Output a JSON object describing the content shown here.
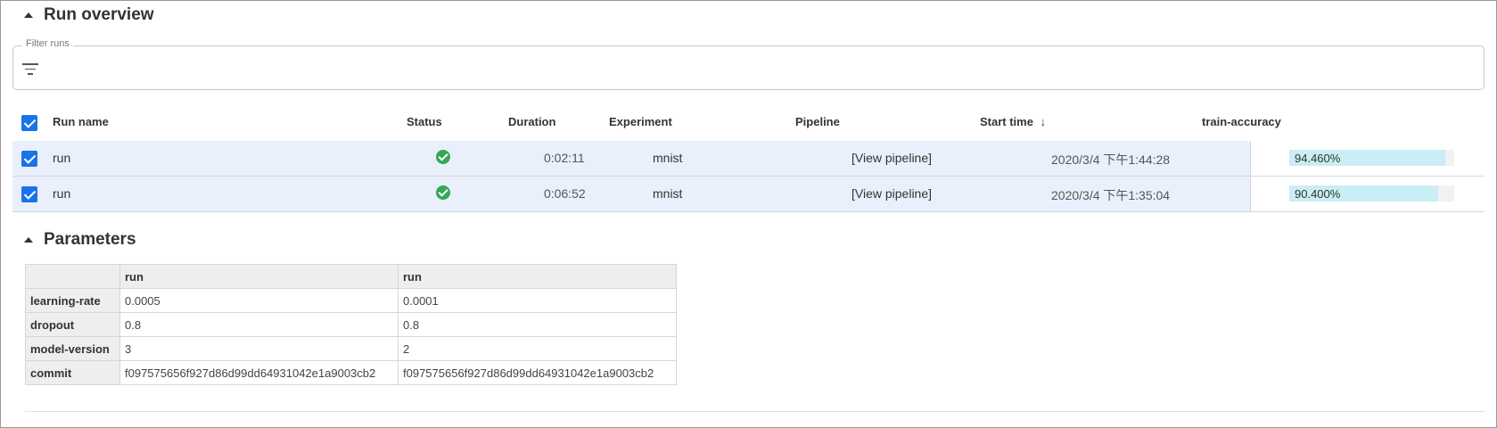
{
  "overview": {
    "title": "Run overview"
  },
  "filter": {
    "label": "Filter runs",
    "value": ""
  },
  "runs_table": {
    "columns": [
      "Run name",
      "Status",
      "Duration",
      "Experiment",
      "Pipeline",
      "Start time",
      "train-accuracy"
    ],
    "sort_indicator": "↓",
    "rows": [
      {
        "name": "run",
        "status": "succeeded",
        "duration": "0:02:11",
        "experiment": "mnist",
        "pipeline": "[View pipeline]",
        "start_time": "2020/3/4 下午1:44:28",
        "metric_label": "94.460%",
        "metric_fraction": 0.9446
      },
      {
        "name": "run",
        "status": "succeeded",
        "duration": "0:06:52",
        "experiment": "mnist",
        "pipeline": "[View pipeline]",
        "start_time": "2020/3/4 下午1:35:04",
        "metric_label": "90.400%",
        "metric_fraction": 0.904
      }
    ]
  },
  "parameters": {
    "title": "Parameters",
    "columns": [
      "run",
      "run"
    ],
    "rows": [
      {
        "key": "learning-rate",
        "values": [
          "0.0005",
          "0.0001"
        ]
      },
      {
        "key": "dropout",
        "values": [
          "0.8",
          "0.8"
        ]
      },
      {
        "key": "model-version",
        "values": [
          "3",
          "2"
        ]
      },
      {
        "key": "commit",
        "values": [
          "f097575656f927d86d99dd64931042e1a9003cb2",
          "f097575656f927d86d99dd64931042e1a9003cb2"
        ]
      }
    ]
  },
  "colors": {
    "accent": "#1a73e8",
    "success": "#34a853",
    "row_selected": "#e9f0fb",
    "metric_fill": "#c9eef3"
  },
  "icons": {
    "filter": "filter-list-icon",
    "status": "check-circle-icon",
    "collapse": "caret-up-icon",
    "sort": "arrow-down-icon"
  }
}
